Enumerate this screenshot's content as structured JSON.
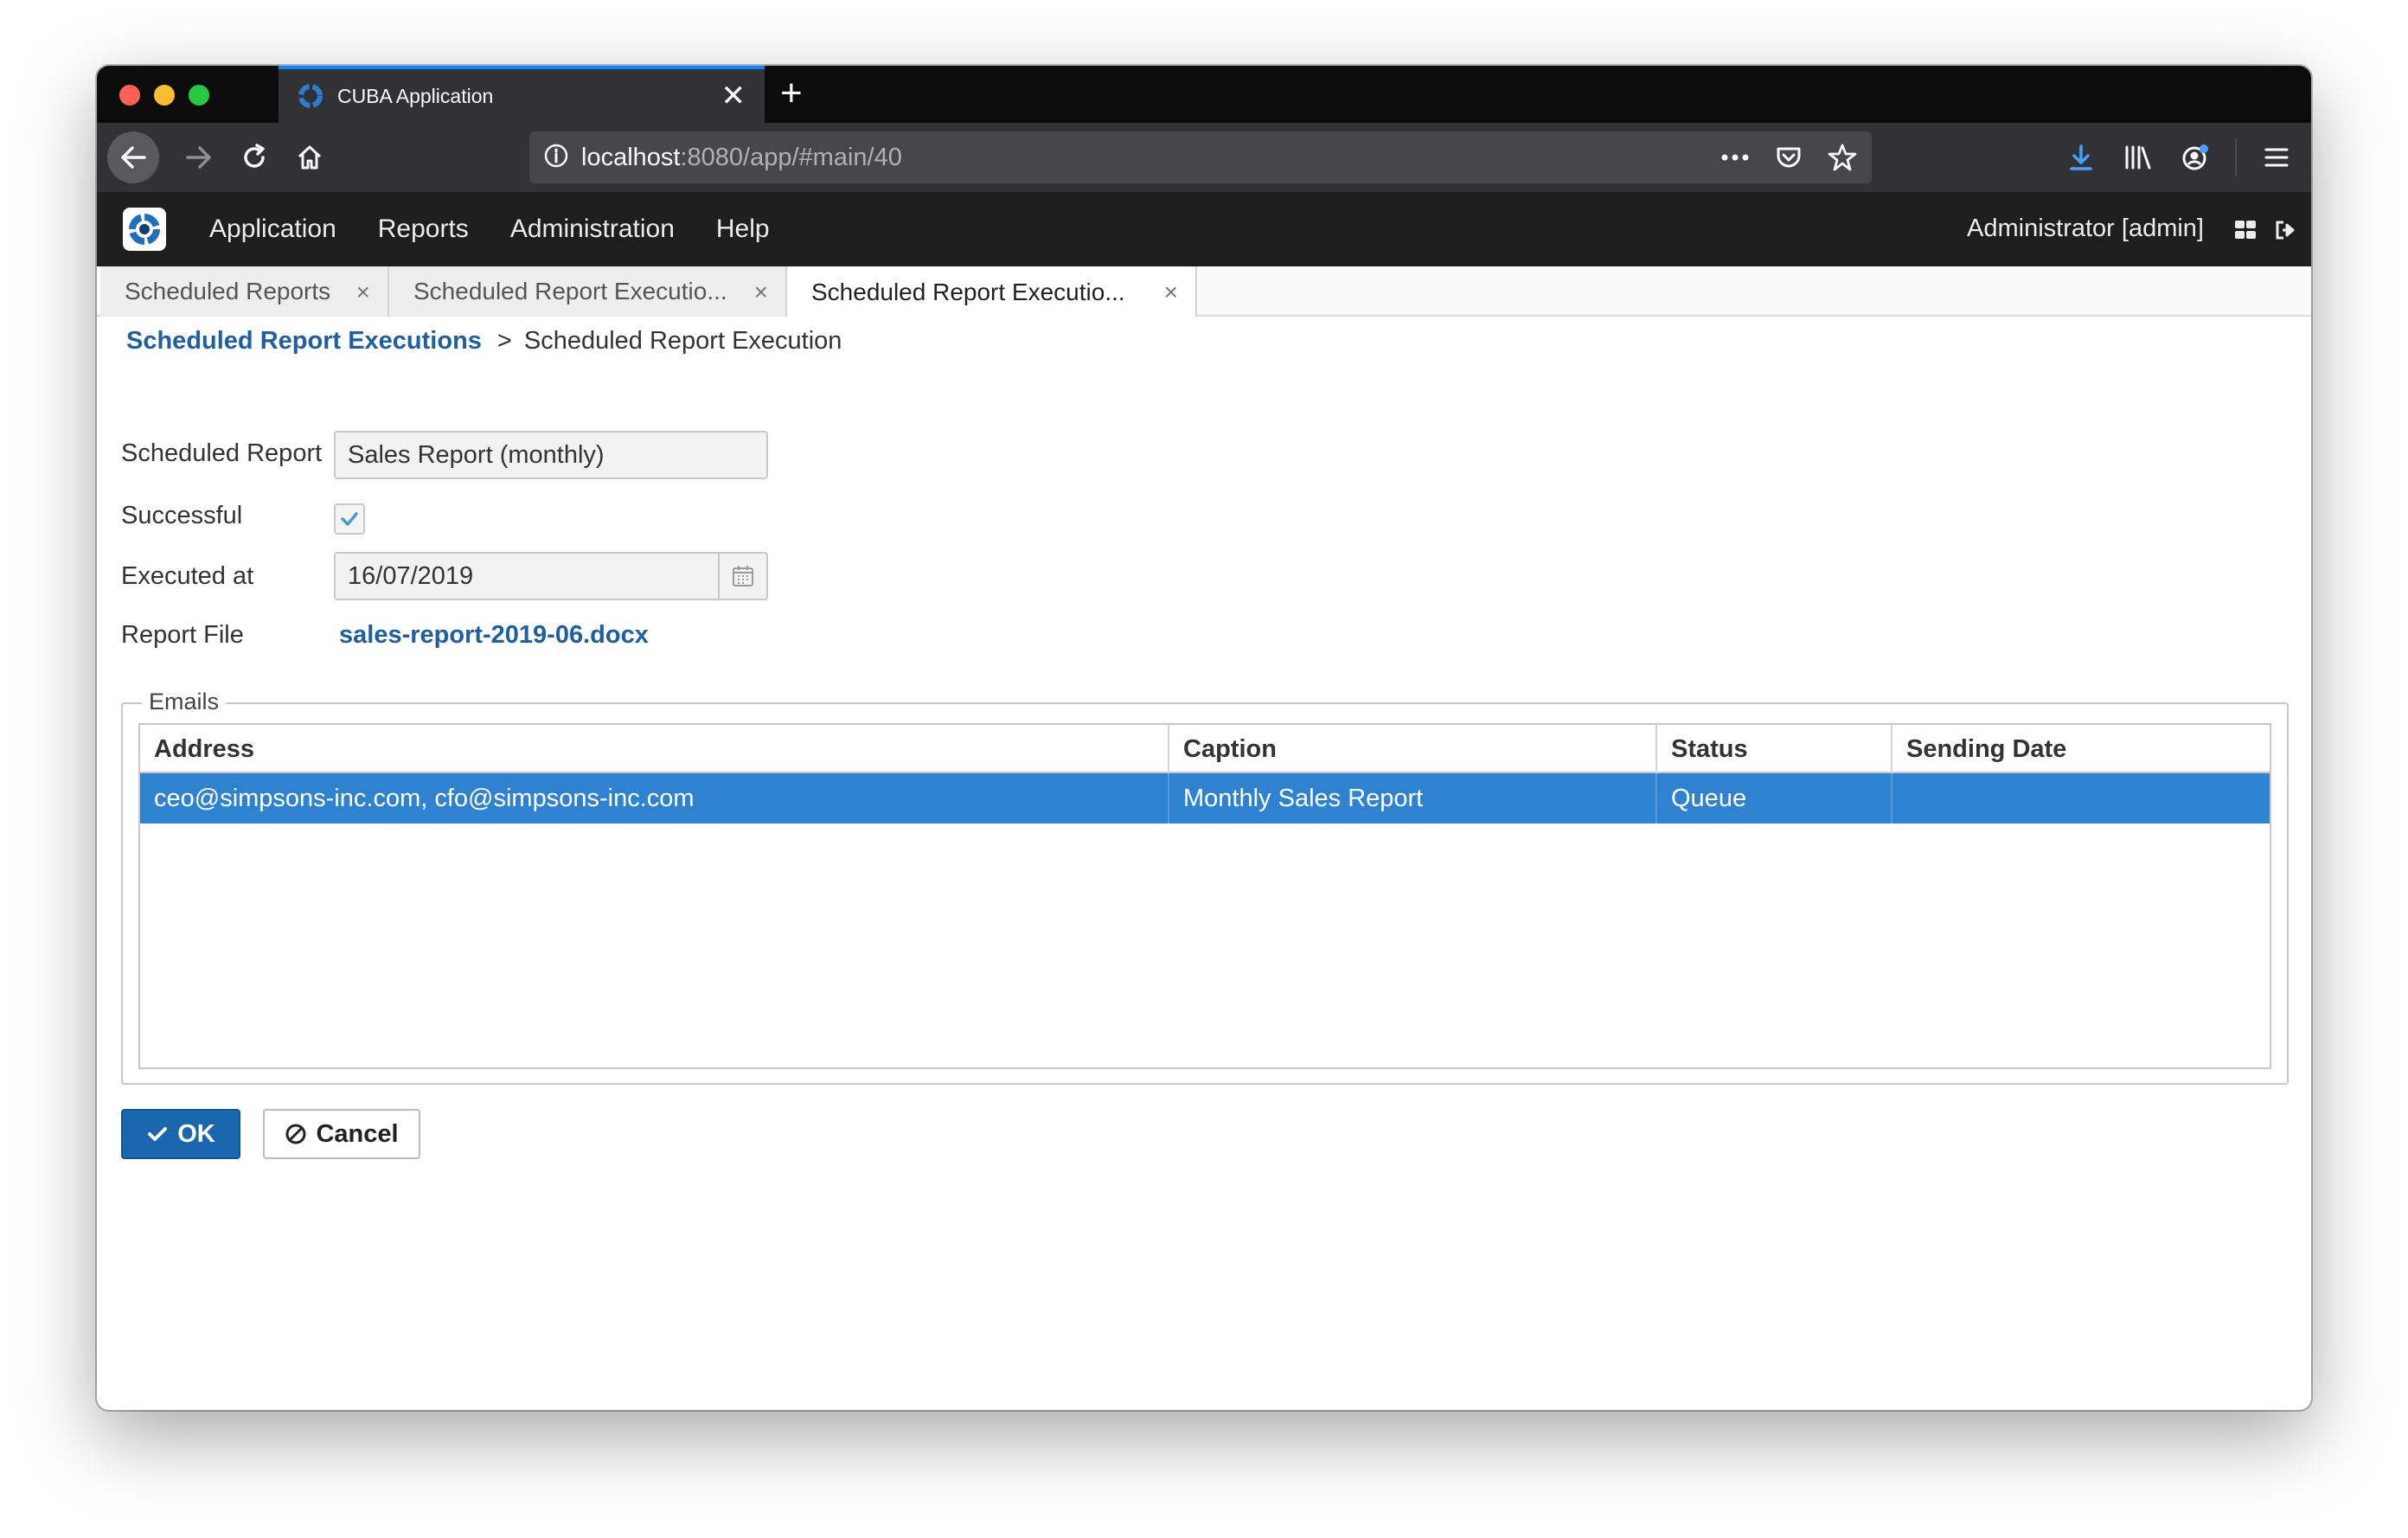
{
  "browser": {
    "tab_title": "CUBA Application",
    "tab_close": "✕",
    "new_tab": "+",
    "url_host": "localhost",
    "url_rest": ":8080/app/#main/40"
  },
  "app": {
    "menu": [
      "Application",
      "Reports",
      "Administration",
      "Help"
    ],
    "user": "Administrator [admin]",
    "tabs": [
      {
        "label": "Scheduled Reports",
        "close": "×"
      },
      {
        "label": "Scheduled Report Executio...",
        "close": "×"
      },
      {
        "label": "Scheduled Report Executio...",
        "close": "×"
      }
    ]
  },
  "breadcrumb": {
    "parent": "Scheduled Report Executions",
    "separator": ">",
    "current": "Scheduled Report Execution"
  },
  "form": {
    "scheduled_report_label": "Scheduled Report",
    "scheduled_report_value": "Sales Report (monthly)",
    "successful_label": "Successful",
    "successful_checked": true,
    "executed_at_label": "Executed at",
    "executed_at_value": "16/07/2019",
    "report_file_label": "Report File",
    "report_file_value": "sales-report-2019-06.docx"
  },
  "emails": {
    "caption": "Emails",
    "columns": [
      "Address",
      "Caption",
      "Status",
      "Sending Date"
    ],
    "rows": [
      [
        "ceo@simpsons-inc.com, cfo@simpsons-inc.com",
        "Monthly Sales Report",
        "Queue",
        ""
      ]
    ]
  },
  "buttons": {
    "ok": "OK",
    "cancel": "Cancel"
  },
  "colors": {
    "accent": "#1b67ad",
    "selected_row": "#2f82cf",
    "link": "#1d5fa1"
  }
}
